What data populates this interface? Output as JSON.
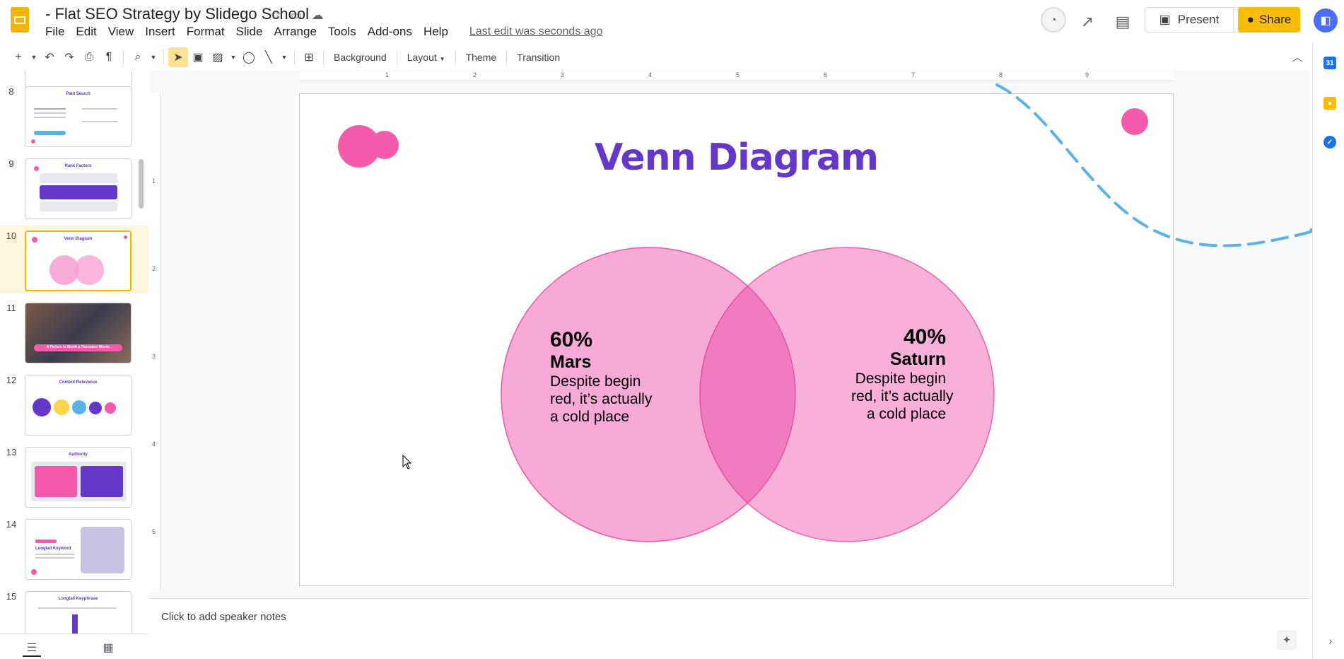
{
  "app": {
    "title": "- Flat SEO Strategy by Slidego School",
    "last_edit": "Last edit was seconds ago",
    "menu": [
      "File",
      "Edit",
      "View",
      "Insert",
      "Format",
      "Slide",
      "Arrange",
      "Tools",
      "Add-ons",
      "Help"
    ],
    "present_label": "Present",
    "share_label": "Share"
  },
  "toolbar": {
    "background_label": "Background",
    "layout_label": "Layout",
    "theme_label": "Theme",
    "transition_label": "Transition"
  },
  "filmstrip": {
    "slides": [
      {
        "number": "8",
        "title": "Paid Search"
      },
      {
        "number": "9",
        "title": "Rank Factors"
      },
      {
        "number": "10",
        "title": "Venn Diagram",
        "selected": true
      },
      {
        "number": "11",
        "title": "A Picture Is Worth a Thousand Words"
      },
      {
        "number": "12",
        "title": "Content Relevance"
      },
      {
        "number": "13",
        "title": "Authority"
      },
      {
        "number": "14",
        "title": "Longtail Keyword"
      },
      {
        "number": "15",
        "title": "Longtail Keyphrase"
      }
    ]
  },
  "ruler": {
    "h_labels": [
      "1",
      "2",
      "3",
      "4",
      "5",
      "6",
      "7",
      "8",
      "9"
    ],
    "v_labels": [
      "1",
      "2",
      "3",
      "4",
      "5"
    ]
  },
  "slide": {
    "title": "Venn Diagram",
    "left": {
      "percent": "60%",
      "planet": "Mars",
      "desc_lines": [
        "Despite begin",
        "red, it’s actually",
        "a cold place"
      ]
    },
    "right": {
      "percent": "40%",
      "planet": "Saturn",
      "desc_lines": [
        "Despite begin",
        "red, it’s actually",
        "a cold place"
      ]
    },
    "colors": {
      "title": "#6438c8",
      "circle_fill": "#f7a3d3",
      "circle_stroke": "#e94aa0",
      "overlap": "#f07bbd",
      "accent_pink": "#f55aab",
      "dash_blue": "#5ab3e6"
    }
  },
  "notes": {
    "placeholder": "Click to add speaker notes"
  }
}
